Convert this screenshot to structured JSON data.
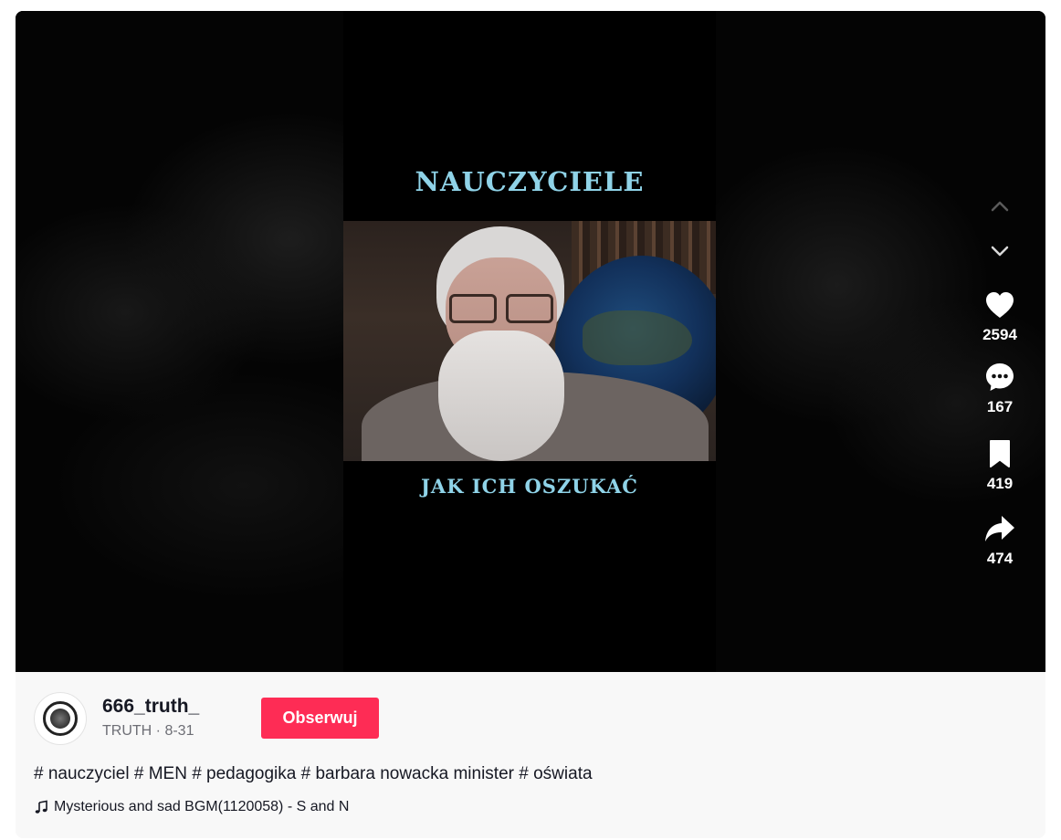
{
  "video": {
    "overlay_title": "NAUCZYCIELE",
    "overlay_subtitle": "JAK ICH OSZUKAĆ"
  },
  "nav": {
    "up_icon": "chevron-up-icon",
    "down_icon": "chevron-down-icon"
  },
  "actions": {
    "likes": "2594",
    "comments": "167",
    "saves": "419",
    "shares": "474"
  },
  "author": {
    "username": "666_truth_",
    "nickname": "TRUTH",
    "separator": " · ",
    "date": "8-31",
    "follow_label": "Obserwuj"
  },
  "description": {
    "hashtags": [
      "# nauczyciel",
      "# MEN",
      "# pedagogika",
      "# barbara nowacka minister",
      "# oświata"
    ]
  },
  "music": {
    "icon": "music-note-icon",
    "title": "Mysterious and sad BGM(1120058) - S and N"
  },
  "colors": {
    "follow_button": "#fe2c55",
    "overlay_text": "#8fd3e8",
    "subtle_text": "#6d6e75"
  }
}
